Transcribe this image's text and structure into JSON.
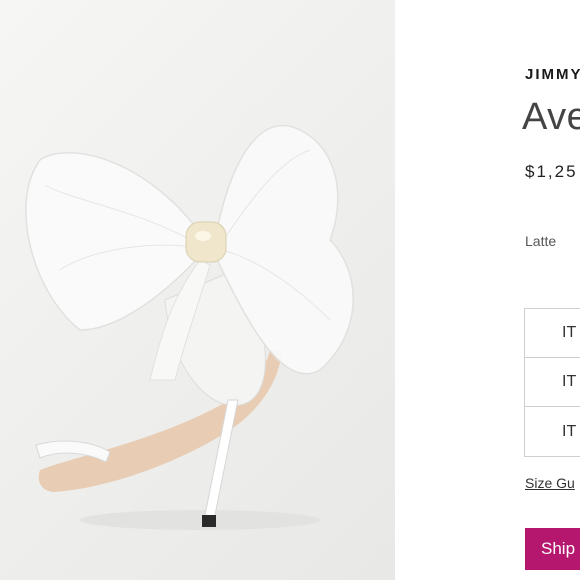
{
  "product": {
    "brand": "JIMMY",
    "name": "Ave",
    "price": "$1,25",
    "color": "Latte"
  },
  "sizes": [
    {
      "label": "IT"
    },
    {
      "label": "IT"
    },
    {
      "label": "IT"
    }
  ],
  "links": {
    "size_guide": "Size Gu"
  },
  "actions": {
    "ship_label": "Ship"
  },
  "colors": {
    "accent": "#b5176e",
    "border": "#cfcfcf",
    "photo_background": "#efefed"
  }
}
